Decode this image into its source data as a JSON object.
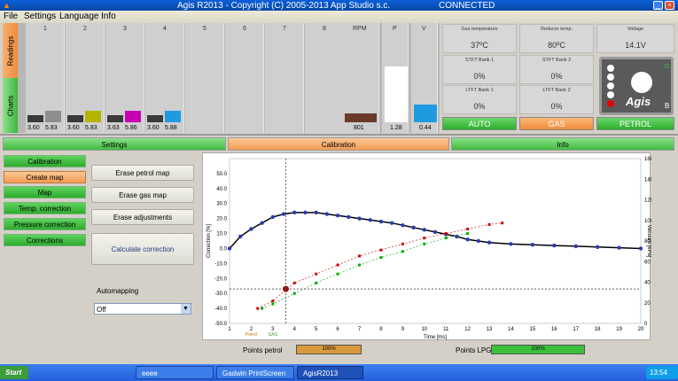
{
  "window": {
    "title": "Agis R2013 - Copyright (C) 2005-2013 App Studio s.c.",
    "status": "CONNECTED"
  },
  "menu": [
    "File",
    "Settings",
    "Language",
    "Info"
  ],
  "side_tabs": {
    "readings": "Readings",
    "charts": "Charts"
  },
  "injectors": [
    {
      "num": "1",
      "petrol": "3.60",
      "gas": "5.83",
      "color": "#8e8e8e"
    },
    {
      "num": "2",
      "petrol": "3.60",
      "gas": "5.83",
      "color": "#b4b400"
    },
    {
      "num": "3",
      "petrol": "3.63",
      "gas": "5.86",
      "color": "#c800b4"
    },
    {
      "num": "4",
      "petrol": "3.60",
      "gas": "5.88",
      "color": "#1e9be0"
    },
    {
      "num": "5"
    },
    {
      "num": "6"
    },
    {
      "num": "7"
    },
    {
      "num": "8"
    }
  ],
  "gauges": {
    "rpm": {
      "label": "RPM",
      "value": "801",
      "color": "#6b3a2a"
    },
    "p": {
      "label": "P",
      "value": "1.28",
      "color": "#ffffff"
    },
    "v": {
      "label": "V",
      "value": "0.44",
      "color": "#1e9be0"
    }
  },
  "stats": {
    "gas_temp": {
      "label": "Gas temperature",
      "value": "37ºC"
    },
    "reducer_temp": {
      "label": "Reducer temp.",
      "value": "80ºC"
    },
    "voltage": {
      "label": "Voltage",
      "value": "14.1V"
    },
    "stft1": {
      "label": "STFT Bank 1",
      "value": "0%"
    },
    "stft2": {
      "label": "STFT Bank 2",
      "value": "0%"
    },
    "ltft1": {
      "label": "LTFT Bank 1",
      "value": "0%"
    },
    "ltft2": {
      "label": "LTFT Bank 2",
      "value": "0%"
    }
  },
  "logo": {
    "text": "Agis",
    "corner_g": "G",
    "corner_b": "B"
  },
  "modes": {
    "auto": "AUTO",
    "gas": "GAS",
    "petrol": "PETROL"
  },
  "tabs": {
    "settings": "Settings",
    "calibration": "Calibration",
    "info": "Info"
  },
  "sidebar": [
    "Calibration",
    "Create map",
    "Map",
    "Temp. correction",
    "Pressure correction",
    "Corrections"
  ],
  "actions": {
    "erase_petrol": "Erase petrol map",
    "erase_gas": "Erase gas map",
    "erase_adj": "Erase adjustments",
    "calc": "Calculate correction"
  },
  "automapping": {
    "label": "Automapping",
    "value": "Off"
  },
  "bottom": {
    "points_petrol_label": "Points petrol",
    "points_petrol_value": "100%",
    "points_lpg_label": "Points LPG",
    "points_lpg_value": "100%"
  },
  "chart_data": {
    "type": "line",
    "xlabel": "Time [ms]",
    "ylabel_left": "Correction [%]",
    "ylabel_right": "Vacuum [kPa]",
    "x_ticks": [
      1,
      2,
      3,
      4,
      5,
      6,
      7,
      8,
      9,
      10,
      11,
      12,
      13,
      14,
      15,
      16,
      17,
      18,
      19,
      20
    ],
    "ylim_left": [
      -50,
      60
    ],
    "y_ticks_left": [
      50.0,
      40.0,
      30.0,
      20.0,
      10.0,
      0.0,
      -10.0,
      -20.0,
      -30.0,
      -40.0,
      -50.0
    ],
    "ylim_right": [
      0,
      160
    ],
    "y_ticks_right": [
      160,
      140,
      120,
      100,
      80,
      60,
      40,
      20,
      0
    ],
    "x_markers": {
      "petrol": "Petrol",
      "gas": "GAS"
    },
    "series": [
      {
        "color": "#000000",
        "points": [
          [
            1,
            0
          ],
          [
            1.5,
            8
          ],
          [
            2,
            13
          ],
          [
            2.5,
            17
          ],
          [
            3,
            21
          ],
          [
            3.5,
            23
          ],
          [
            4,
            24
          ],
          [
            4.5,
            24
          ],
          [
            5,
            24
          ],
          [
            5.5,
            23
          ],
          [
            6,
            22
          ],
          [
            6.5,
            21
          ],
          [
            7,
            20
          ],
          [
            7.5,
            19
          ],
          [
            8,
            18
          ],
          [
            8.5,
            17
          ],
          [
            9,
            15.5
          ],
          [
            9.5,
            14
          ],
          [
            10,
            12.5
          ],
          [
            10.5,
            11
          ],
          [
            11,
            9.5
          ],
          [
            11.5,
            8
          ],
          [
            12,
            6
          ],
          [
            12.5,
            5
          ],
          [
            13,
            4
          ],
          [
            14,
            3
          ],
          [
            15,
            2.5
          ],
          [
            16,
            2
          ],
          [
            17,
            1.5
          ],
          [
            18,
            1
          ],
          [
            19,
            0.5
          ],
          [
            20,
            0
          ]
        ]
      },
      {
        "color": "#cc0000",
        "points": [
          [
            2.3,
            -40
          ],
          [
            3,
            -35
          ],
          [
            4,
            -23
          ],
          [
            5,
            -17
          ],
          [
            6,
            -11
          ],
          [
            7,
            -5
          ],
          [
            8,
            -1
          ],
          [
            9,
            3
          ],
          [
            10,
            7
          ],
          [
            11,
            10
          ],
          [
            12,
            13
          ],
          [
            13,
            16
          ],
          [
            13.6,
            17
          ]
        ]
      },
      {
        "color": "#00aa00",
        "points": [
          [
            2.5,
            -40
          ],
          [
            3,
            -37
          ],
          [
            4,
            -30
          ],
          [
            5,
            -23
          ],
          [
            6,
            -17
          ],
          [
            7,
            -11
          ],
          [
            8,
            -6
          ],
          [
            9,
            -2
          ],
          [
            10,
            3
          ],
          [
            11,
            7
          ],
          [
            12,
            10
          ]
        ]
      }
    ]
  }
}
